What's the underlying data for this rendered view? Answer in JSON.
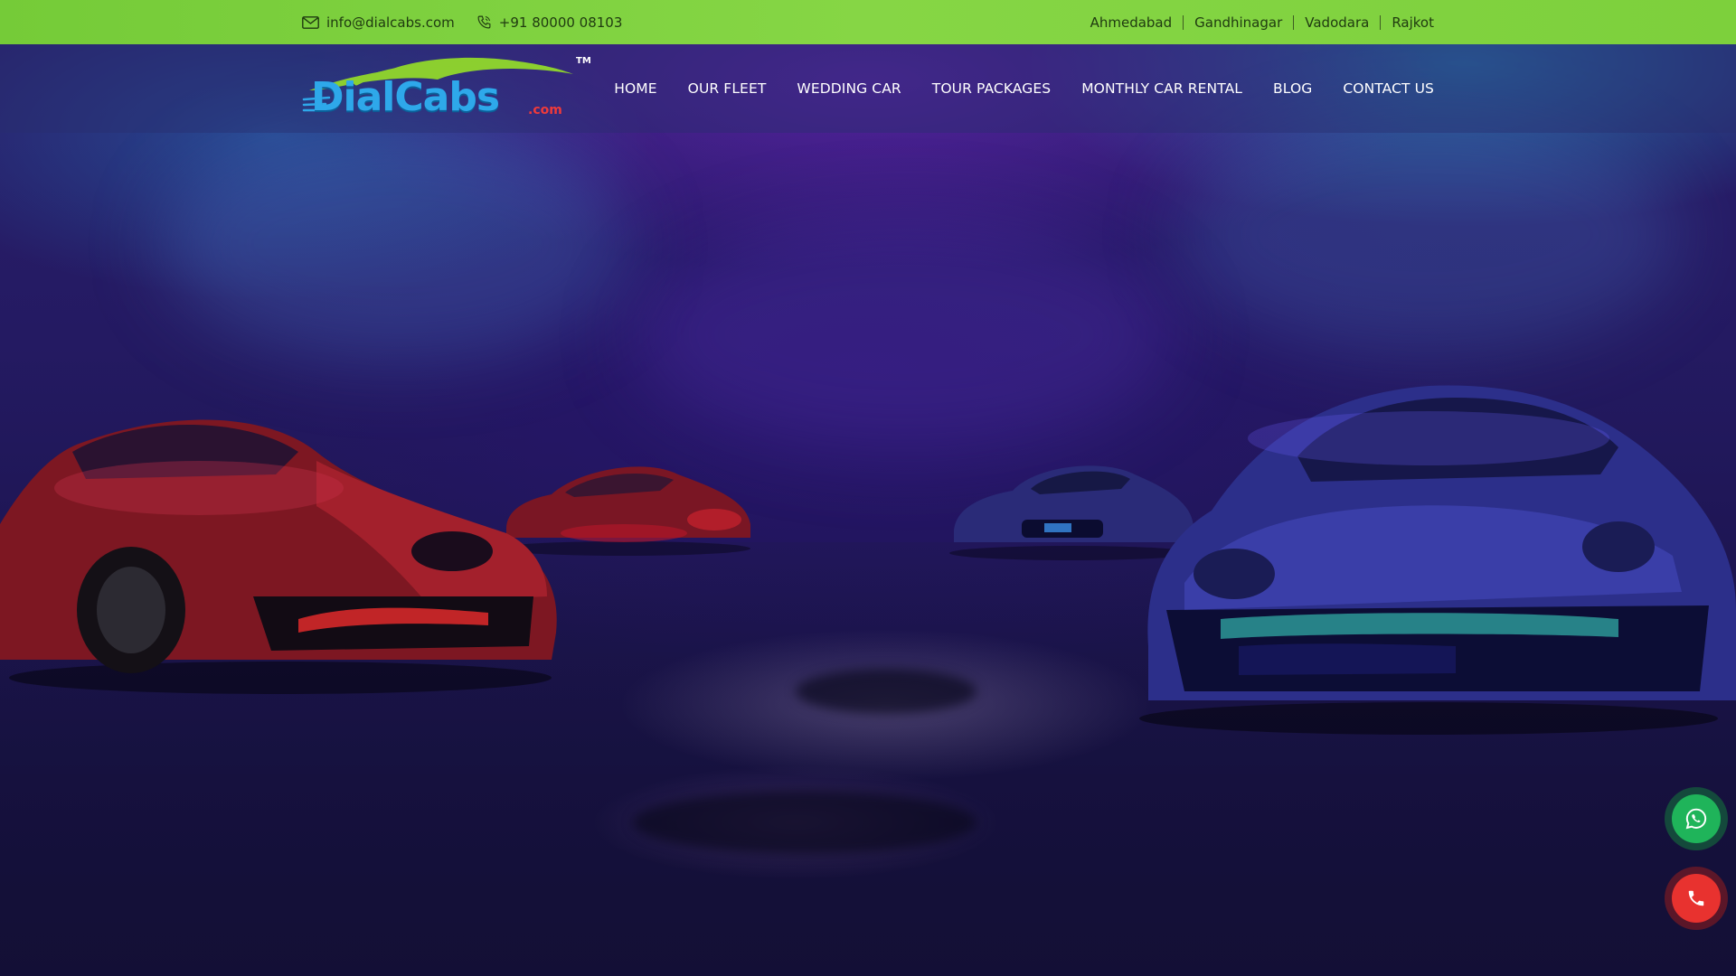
{
  "topbar": {
    "email": "info@dialcabs.com",
    "phone": "+91 80000 08103",
    "cities": [
      "Ahmedabad",
      "Gandhinagar",
      "Vadodara",
      "Rajkot"
    ]
  },
  "header": {
    "logo": {
      "text": "DialCabs",
      "sub": ".com",
      "tm": "TM"
    },
    "nav": [
      "HOME",
      "OUR FLEET",
      "WEDDING CAR",
      "TOUR PACKAGES",
      "MONTHLY CAR RENTAL",
      "BLOG",
      "CONTACT US"
    ]
  },
  "floating": {
    "whatsapp_icon": "whatsapp-icon",
    "phone_icon": "phone-icon"
  },
  "colors": {
    "topbar_bg": "#7ccf3c",
    "whatsapp": "#1fb45a",
    "call": "#e8322f",
    "logo_blue": "#2ea8ea",
    "logo_green": "#8ccf2f"
  }
}
